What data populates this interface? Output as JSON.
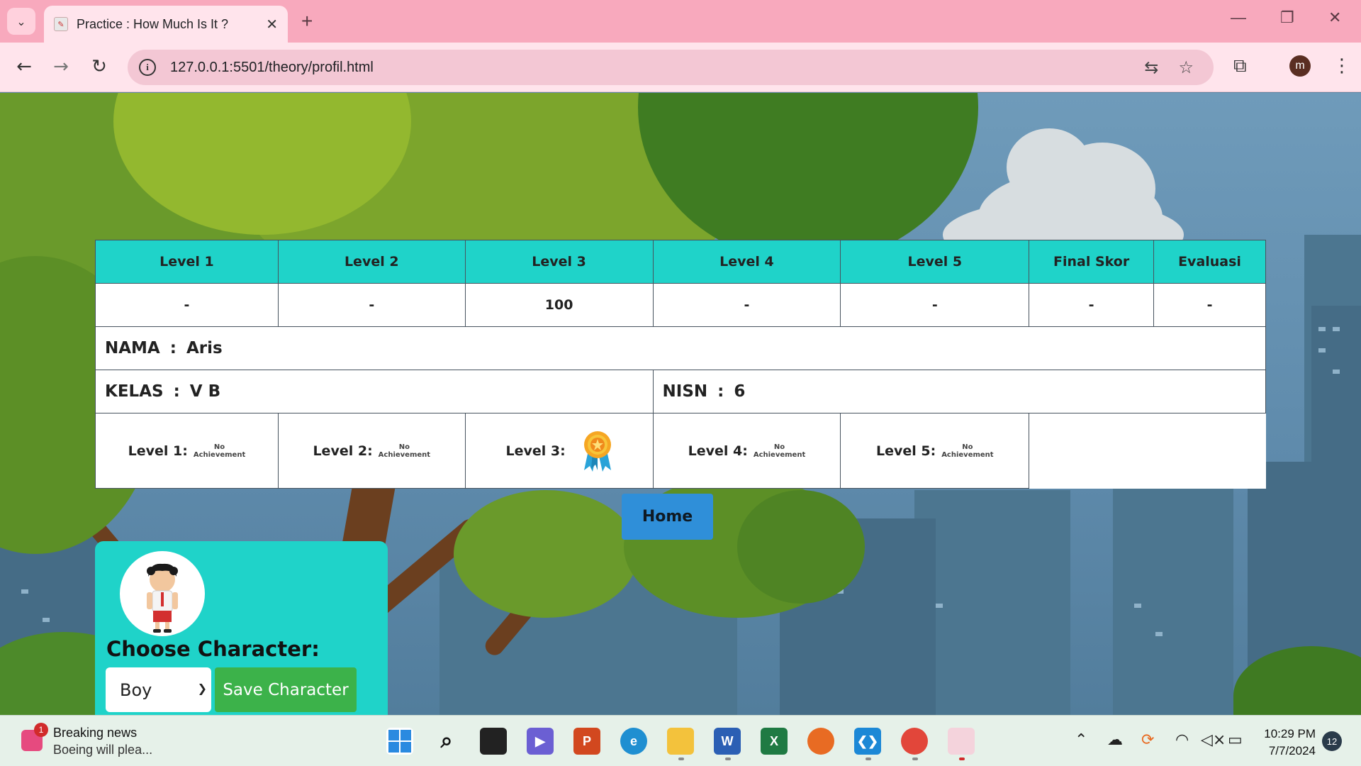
{
  "browser": {
    "tab_title": "Practice : How Much Is It ?",
    "tab_close": "✕",
    "new_tab": "+",
    "url": "127.0.0.1:5501/theory/profil.html",
    "avatar_letter": "m"
  },
  "scores": {
    "headers": [
      "Level 1",
      "Level 2",
      "Level 3",
      "Level 4",
      "Level 5",
      "Final Skor",
      "Evaluasi"
    ],
    "values": [
      "-",
      "-",
      "100",
      "-",
      "-",
      "-",
      "-"
    ]
  },
  "student": {
    "nama_label": "NAMA",
    "nama_value": "Aris",
    "kelas_label": "KELAS",
    "kelas_value": "V B",
    "nisn_label": "NISN",
    "nisn_value": "6",
    "separator": ":"
  },
  "achievements": [
    {
      "label": "Level 1:",
      "status_line1": "No",
      "status_line2": "Achievement",
      "achieved": false
    },
    {
      "label": "Level 2:",
      "status_line1": "No",
      "status_line2": "Achievement",
      "achieved": false
    },
    {
      "label": "Level 3:",
      "status_line1": "",
      "status_line2": "",
      "achieved": true
    },
    {
      "label": "Level 4:",
      "status_line1": "No",
      "status_line2": "Achievement",
      "achieved": false
    },
    {
      "label": "Level 5:",
      "status_line1": "No",
      "status_line2": "Achievement",
      "achieved": false
    }
  ],
  "home_button": "Home",
  "character": {
    "title": "Choose Character:",
    "selected": "Boy",
    "save_label": "Save Character"
  },
  "taskbar": {
    "news_badge": "1",
    "news_title": "Breaking news",
    "news_sub": "Boeing will plea...",
    "time": "10:29 PM",
    "date": "7/7/2024",
    "notifications": "12",
    "apps": [
      "start",
      "search",
      "task-view",
      "teams",
      "powerpoint",
      "edge",
      "file-explorer",
      "word",
      "excel",
      "firefox",
      "vscode",
      "chrome",
      "snipping-tool"
    ]
  },
  "colors": {
    "table_header": "#1fd3c9",
    "home_button": "#2f8fd9",
    "save_button": "#3cb24a",
    "tabbar": "#f8a9bd",
    "toolbar": "#ffe4ec"
  }
}
